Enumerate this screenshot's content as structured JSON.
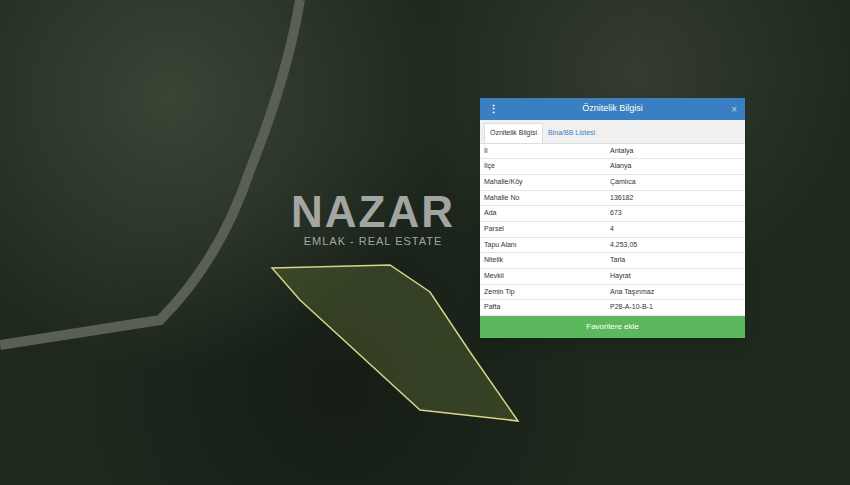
{
  "watermark": {
    "logo": "NAZAR",
    "subtitle": "EMLAK - REAL ESTATE"
  },
  "popup": {
    "menu_icon": "⋮",
    "title": "Öznitelik Bilgisi",
    "close": "×",
    "tabs": [
      {
        "label": "Öznitelik Bilgisi",
        "selected": true
      },
      {
        "label": "Bina/BB Listesi",
        "selected": false
      }
    ],
    "rows": [
      [
        "İl",
        "Antalya"
      ],
      [
        "İlçe",
        "Alanya"
      ],
      [
        "Mahalle/Köy",
        "Çamlıca"
      ],
      [
        "Mahalle No",
        "136182"
      ],
      [
        "Ada",
        "673"
      ],
      [
        "Parsel",
        "4"
      ],
      [
        "Tapu Alanı",
        "4.253,05"
      ],
      [
        "Nitelik",
        "Tarla"
      ],
      [
        "Mevkii",
        "Hayrat"
      ],
      [
        "Zemin Tip",
        "Ana Taşınmaz"
      ],
      [
        "Pafta",
        "P28-A-10-B-1"
      ]
    ],
    "button": "Favorilere ekle"
  }
}
